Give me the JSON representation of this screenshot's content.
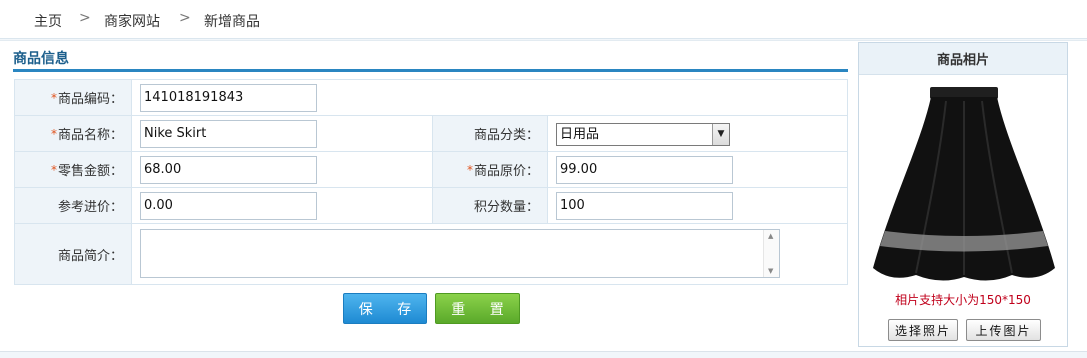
{
  "breadcrumb": {
    "home": "主页",
    "site": "商家网站",
    "current": "新增商品",
    "separator": ">"
  },
  "section_title": "商品信息",
  "form": {
    "code": {
      "label": "商品编码：",
      "value": "141018191843",
      "required": true
    },
    "name": {
      "label": "商品名称：",
      "value": "Nike Skirt",
      "required": true
    },
    "category": {
      "label": "商品分类：",
      "value": "日用品"
    },
    "retail": {
      "label": "零售金额：",
      "value": "68.00",
      "required": true
    },
    "original": {
      "label": "商品原价：",
      "value": "99.00",
      "required": true
    },
    "cost": {
      "label": "参考进价：",
      "value": "0.00"
    },
    "points": {
      "label": "积分数量：",
      "value": "100"
    },
    "description": {
      "label": "商品简介：",
      "value": ""
    },
    "required_mark": "*"
  },
  "buttons": {
    "save": "保 存",
    "reset": "重 置"
  },
  "photo": {
    "title": "商品相片",
    "hint": "相片支持大小为150*150",
    "choose": "选择照片",
    "upload": "上传图片"
  },
  "colors": {
    "accent": "#2a86c1",
    "save": "#2490d8",
    "reset": "#6bbb36",
    "hint": "#c0001b",
    "required": "#e0531f"
  }
}
